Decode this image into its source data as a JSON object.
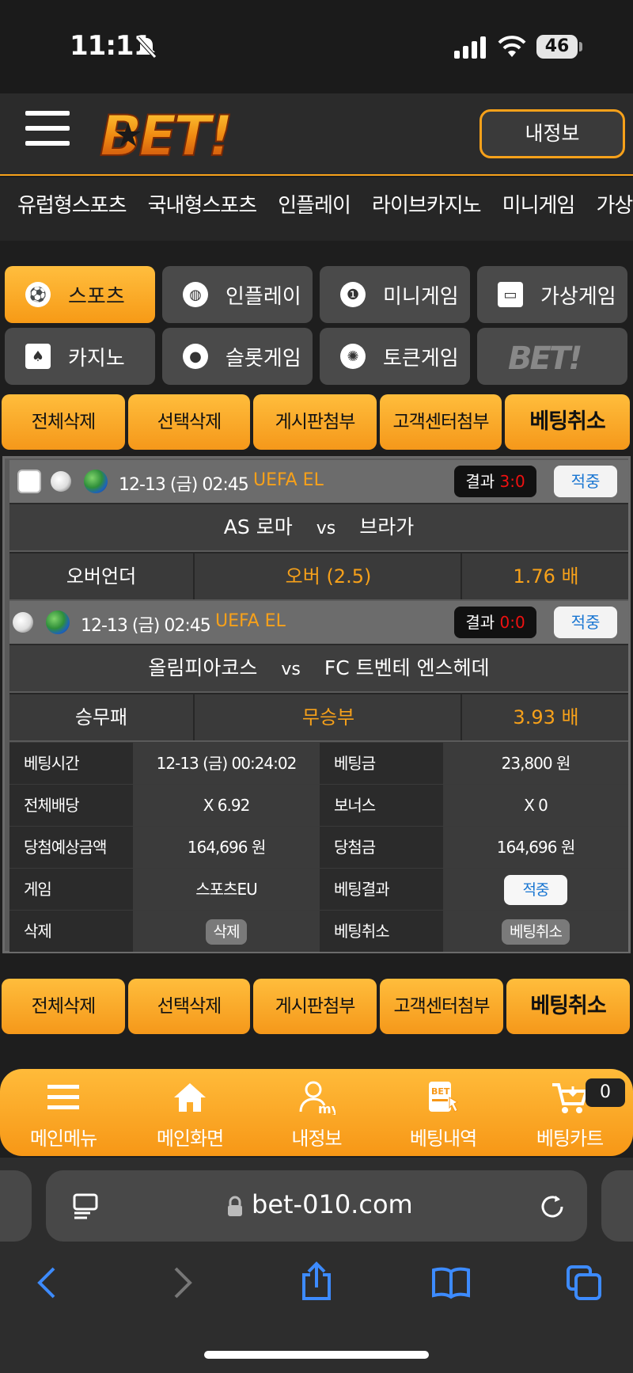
{
  "status": {
    "time": "11:11",
    "battery": "46"
  },
  "header": {
    "myinfo": "내정보"
  },
  "nav": [
    "유럽형스포츠",
    "국내형스포츠",
    "인플레이",
    "라이브카지노",
    "미니게임",
    "가상게"
  ],
  "categories": [
    {
      "label": "스포츠",
      "icon": "soccer-ball-icon",
      "active": true
    },
    {
      "label": "인플레이",
      "icon": "volleyball-icon"
    },
    {
      "label": "미니게임",
      "icon": "mini-game-icon"
    },
    {
      "label": "가상게임",
      "icon": "virtual-game-icon"
    },
    {
      "label": "카지노",
      "icon": "cards-icon"
    },
    {
      "label": "슬롯게임",
      "icon": "football-icon"
    },
    {
      "label": "토큰게임",
      "icon": "token-chip-icon"
    }
  ],
  "actions": [
    "전체삭제",
    "선택삭제",
    "게시판첨부",
    "고객센터첨부",
    "베팅취소"
  ],
  "matches": [
    {
      "date": "12-13 (금) 02:45",
      "league": "UEFA EL",
      "result_label": "결과",
      "score": "3:0",
      "hit": "적중",
      "home": "AS 로마",
      "vs": "vs",
      "away": "브라가",
      "market": "오버언더",
      "pick": "오버 (2.5)",
      "odds": "1.76 배"
    },
    {
      "date": "12-13 (금) 02:45",
      "league": "UEFA EL",
      "result_label": "결과",
      "score": "0:0",
      "hit": "적중",
      "home": "올림피아코스",
      "vs": "vs",
      "away": "FC 트벤테 엔스헤데",
      "market": "승무패",
      "pick": "무승부",
      "odds": "3.93 배"
    }
  ],
  "info": {
    "bet_time_label": "베팅시간",
    "bet_time": "12-13 (금) 00:24:02",
    "bet_amount_label": "베팅금",
    "bet_amount": "23,800 원",
    "total_odds_label": "전체배당",
    "total_odds": "X 6.92",
    "bonus_label": "보너스",
    "bonus": "X 0",
    "expected_label": "당첨예상금액",
    "expected": "164,696 원",
    "win_label": "당첨금",
    "win": "164,696 원",
    "game_label": "게임",
    "game": "스포츠EU",
    "result_label": "베팅결과",
    "result": "적중",
    "delete_label": "삭제",
    "delete_btn": "삭제",
    "cancel_label": "베팅취소",
    "cancel_btn": "베팅취소"
  },
  "bottom_menu": [
    "메인메뉴",
    "메인화면",
    "내정보",
    "베팅내역",
    "베팅카트"
  ],
  "cart_count": "0",
  "browser": {
    "url": "bet-010.com"
  },
  "colors": {
    "accent": "#f7a11a",
    "hit": "#1976d2",
    "score": "#e11111"
  }
}
